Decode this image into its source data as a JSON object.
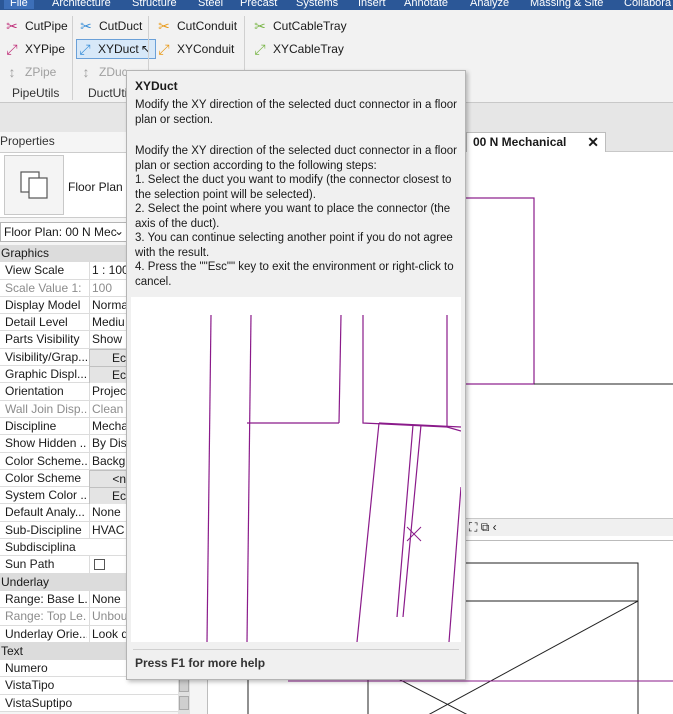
{
  "menu": {
    "tabs": [
      "File",
      "Architecture",
      "Structure",
      "Steel",
      "Precast",
      "Systems",
      "Insert",
      "Annotate",
      "Analyze",
      "Massing & Site",
      "Collabora"
    ]
  },
  "ribbon": {
    "pipe_utils": {
      "cut": "CutPipe",
      "xy": "XYPipe",
      "z": "ZPipe",
      "group": "PipeUtils"
    },
    "duct_utils": {
      "cut": "CutDuct",
      "xy": "XYDuct",
      "z": "ZDuc",
      "group": "DuctUtils"
    },
    "conduit": {
      "cut": "CutConduit",
      "xy": "XYConduit"
    },
    "cabletray": {
      "cut": "CutCableTray",
      "xy": "XYCableTray"
    }
  },
  "properties": {
    "title": "Properties",
    "type_label": "Floor Plan",
    "selector": "Floor Plan: 00 N Mec",
    "rows": [
      {
        "kind": "section",
        "k": "Graphics"
      },
      {
        "kind": "row",
        "k": "View Scale",
        "v": "1 : 100"
      },
      {
        "kind": "dim",
        "k": "Scale Value    1:",
        "v": "100"
      },
      {
        "kind": "row",
        "k": "Display Model",
        "v": "Norma"
      },
      {
        "kind": "row",
        "k": "Detail Level",
        "v": "Mediu"
      },
      {
        "kind": "row",
        "k": "Parts Visibility",
        "v": "Show C"
      },
      {
        "kind": "btn",
        "k": "Visibility/Grap...",
        "v": "Ec"
      },
      {
        "kind": "btn",
        "k": "Graphic Displ...",
        "v": "Ec"
      },
      {
        "kind": "row",
        "k": "Orientation",
        "v": "Project"
      },
      {
        "kind": "dim",
        "k": "Wall Join Disp...",
        "v": "Clean a"
      },
      {
        "kind": "row",
        "k": "Discipline",
        "v": "Mechan"
      },
      {
        "kind": "row",
        "k": "Show Hidden ...",
        "v": "By Disc"
      },
      {
        "kind": "row",
        "k": "Color Scheme...",
        "v": "Backgr"
      },
      {
        "kind": "btn",
        "k": "Color Scheme",
        "v": "<n"
      },
      {
        "kind": "btn",
        "k": "System Color ...",
        "v": "Ec"
      },
      {
        "kind": "row",
        "k": "Default Analy...",
        "v": "None"
      },
      {
        "kind": "row",
        "k": "Sub-Discipline",
        "v": "HVAC"
      },
      {
        "kind": "row",
        "k": "Subdisciplina",
        "v": ""
      },
      {
        "kind": "check",
        "k": "Sun Path",
        "v": ""
      },
      {
        "kind": "section",
        "k": "Underlay"
      },
      {
        "kind": "row",
        "k": "Range: Base L...",
        "v": "None"
      },
      {
        "kind": "dim",
        "k": "Range: Top Le...",
        "v": "Unbou"
      },
      {
        "kind": "row",
        "k": "Underlay Orie...",
        "v": "Look do"
      },
      {
        "kind": "section",
        "k": "Text"
      },
      {
        "kind": "row",
        "k": "Numero",
        "v": ""
      },
      {
        "kind": "row",
        "k": "VistaTipo",
        "v": ""
      },
      {
        "kind": "row",
        "k": "VistaSuptipo",
        "v": ""
      }
    ]
  },
  "view": {
    "tab_label": "00 N Mechanical",
    "close_glyph": "✕"
  },
  "tooltip": {
    "title": "XYDuct",
    "short": "Modify the XY direction of the selected duct connector in a floor plan or section.",
    "body": [
      "Modify the XY direction of the selected duct connector in a floor plan or section according to the following steps:",
      "1. Select the duct you want to modify (the connector closest to the selection point will be selected).",
      "2. Select the point where you want to place the connector (the axis of the duct).",
      "3. You can continue selecting another point if you do not agree with the result.",
      "4. Press the \"\"Esc\"\" key to exit the environment or right-click to cancel."
    ],
    "footer": "Press F1 for more help"
  },
  "colors": {
    "accent": "#2b5797",
    "duct_line": "#8a1a8a",
    "pipe_icon": "#c0307a",
    "duct_icon": "#3a8fd8",
    "conduit_icon": "#e89a1a",
    "cabletray_icon": "#7ab648"
  }
}
